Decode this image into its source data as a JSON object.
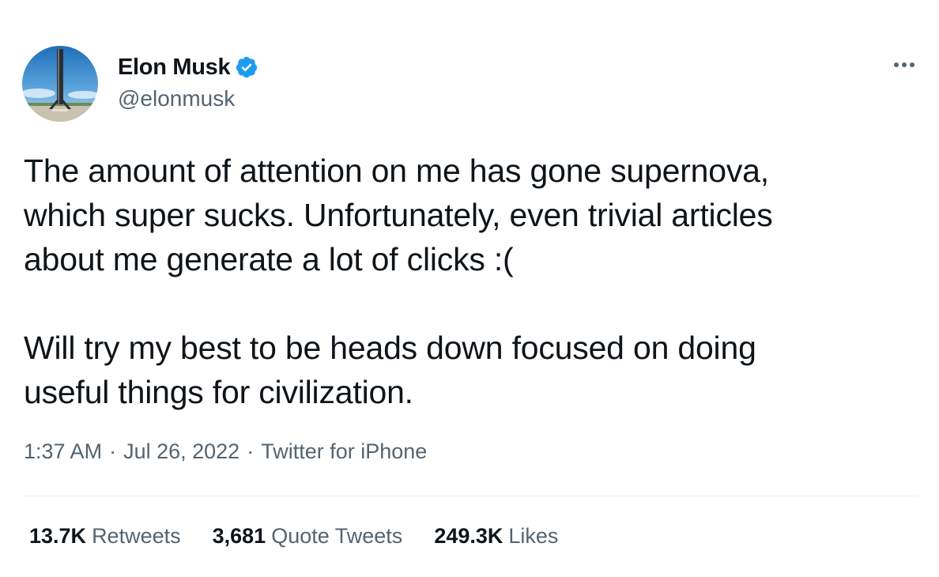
{
  "author": {
    "display_name": "Elon Musk",
    "handle": "@elonmusk",
    "verified": true,
    "verified_color": "#1d9bf0",
    "avatar_icon": "rocket-booster-avatar"
  },
  "more_icon": "ellipsis-icon",
  "tweet": {
    "paragraph_1": "The amount of attention on me has gone supernova,\nwhich super sucks. Unfortunately, even trivial articles\nabout me generate a lot of clicks :(",
    "paragraph_2": "Will try my best to be heads down focused on doing\nuseful things for civilization."
  },
  "meta": {
    "time": "1:37 AM",
    "separator": "·",
    "date": "Jul 26, 2022",
    "source": "Twitter for iPhone"
  },
  "stats": {
    "retweets_count": "13.7K",
    "retweets_label": "Retweets",
    "quotes_count": "3,681",
    "quotes_label": "Quote Tweets",
    "likes_count": "249.3K",
    "likes_label": "Likes"
  },
  "colors": {
    "text_primary": "#0f1419",
    "text_secondary": "#536471",
    "divider": "#eff3f4"
  }
}
